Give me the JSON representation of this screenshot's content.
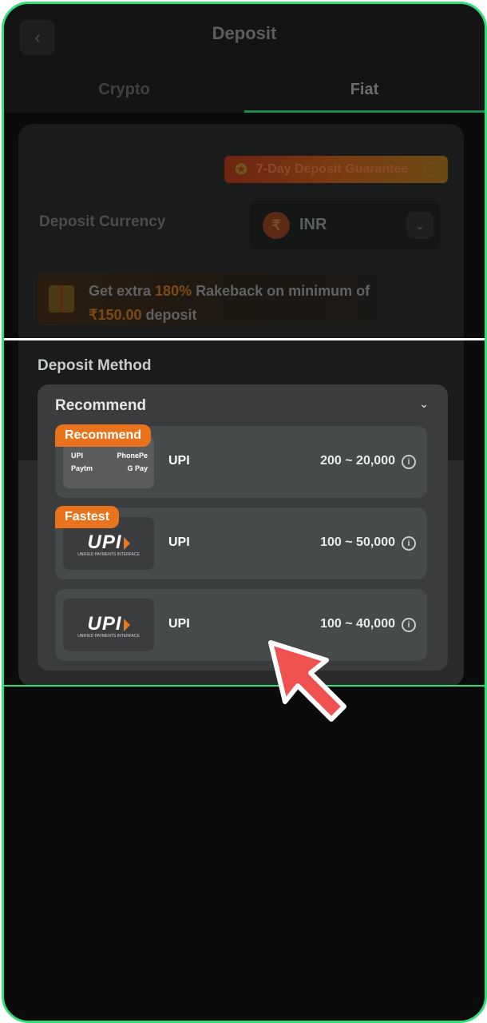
{
  "header": {
    "title": "Deposit",
    "back_glyph": "‹"
  },
  "tabs": [
    {
      "label": "Crypto",
      "active": false
    },
    {
      "label": "Fiat",
      "active": true
    }
  ],
  "guarantee": {
    "label": "7-Day Deposit Guarantee",
    "help_glyph": "?"
  },
  "currency": {
    "label": "Deposit Currency",
    "symbol": "₹",
    "code": "INR",
    "chevron": "⌄"
  },
  "rakeback": {
    "prefix": "Get extra ",
    "percent": "180%",
    "middle": " Rakeback on minimum of",
    "amount": "₹150.00",
    "suffix": " deposit"
  },
  "method": {
    "title": "Deposit Method",
    "group_title": "Recommend",
    "group_chevron": "⌄",
    "options": [
      {
        "badge": "Recommend",
        "name": "UPI",
        "range": "200 ~ 20,000",
        "logos": [
          "UPI",
          "PhonePe",
          "Paytm",
          "G Pay"
        ]
      },
      {
        "badge": "Fastest",
        "name": "UPI",
        "range": "100 ~ 50,000",
        "logo": "UPI",
        "logo_sub": "UNIFIED PAYMENTS INTERFACE"
      },
      {
        "badge": "",
        "name": "UPI",
        "range": "100 ~ 40,000",
        "logo": "UPI",
        "logo_sub": "UNIFIED PAYMENTS INTERFACE"
      }
    ],
    "info_glyph": "i"
  },
  "colors": {
    "accent_green": "#2ee07a",
    "badge_orange": "#e8731c",
    "cursor_red": "#f05252"
  }
}
